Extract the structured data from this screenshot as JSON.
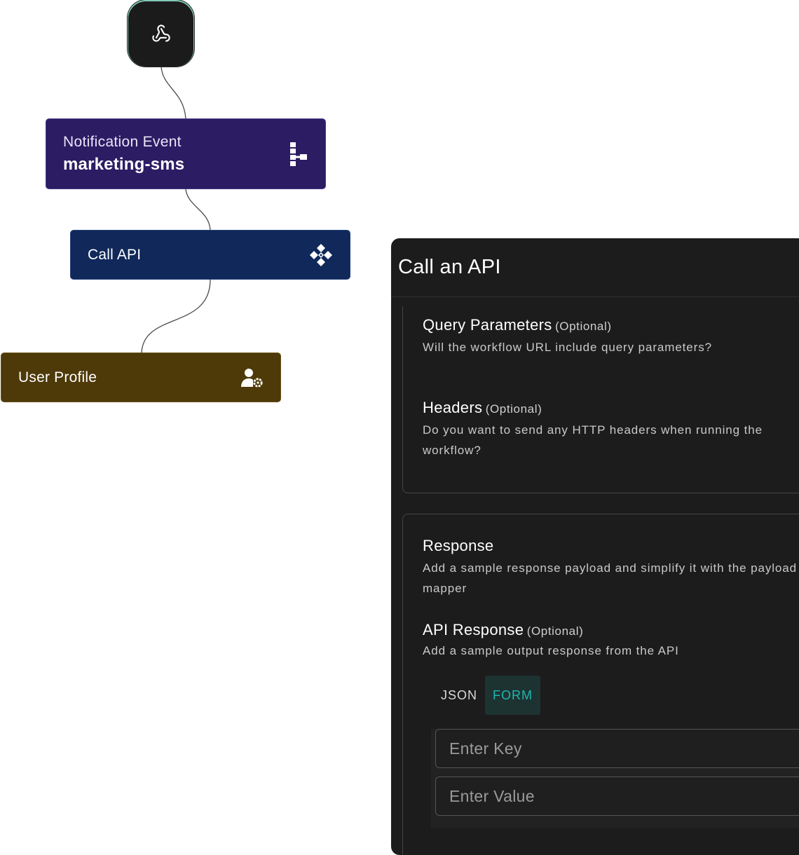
{
  "flow": {
    "trigger": {
      "icon": "webhook-icon"
    },
    "notification_node": {
      "title": "Notification Event",
      "subtitle": "marketing-sms",
      "icon": "hierarchy-icon",
      "color": "#2c1c64"
    },
    "call_api_node": {
      "label": "Call API",
      "icon": "diamond-nodes-icon",
      "color": "#10285a"
    },
    "user_profile_node": {
      "label": "User Profile",
      "icon": "user-gear-icon",
      "color": "#4e3a08"
    }
  },
  "panel": {
    "title": "Call an API",
    "query_params": {
      "title": "Query Parameters",
      "optional": "(Optional)",
      "description": "Will the workflow URL include query parameters?"
    },
    "headers": {
      "title": "Headers",
      "optional": "(Optional)",
      "description": "Do you want to send any HTTP headers when running the workflow?"
    },
    "response": {
      "title": "Response",
      "description": "Add a sample response payload and simplify it with the payload mapper"
    },
    "api_response": {
      "title": "API Response",
      "optional": "(Optional)",
      "description": "Add a sample output response from the API"
    },
    "tabs": [
      {
        "label": "JSON",
        "active": false
      },
      {
        "label": "FORM",
        "active": true
      }
    ],
    "key_input": {
      "placeholder": "Enter Key",
      "value": ""
    },
    "value_input": {
      "placeholder": "Enter Value",
      "value": ""
    },
    "accent_color": "#1fb6b0"
  }
}
